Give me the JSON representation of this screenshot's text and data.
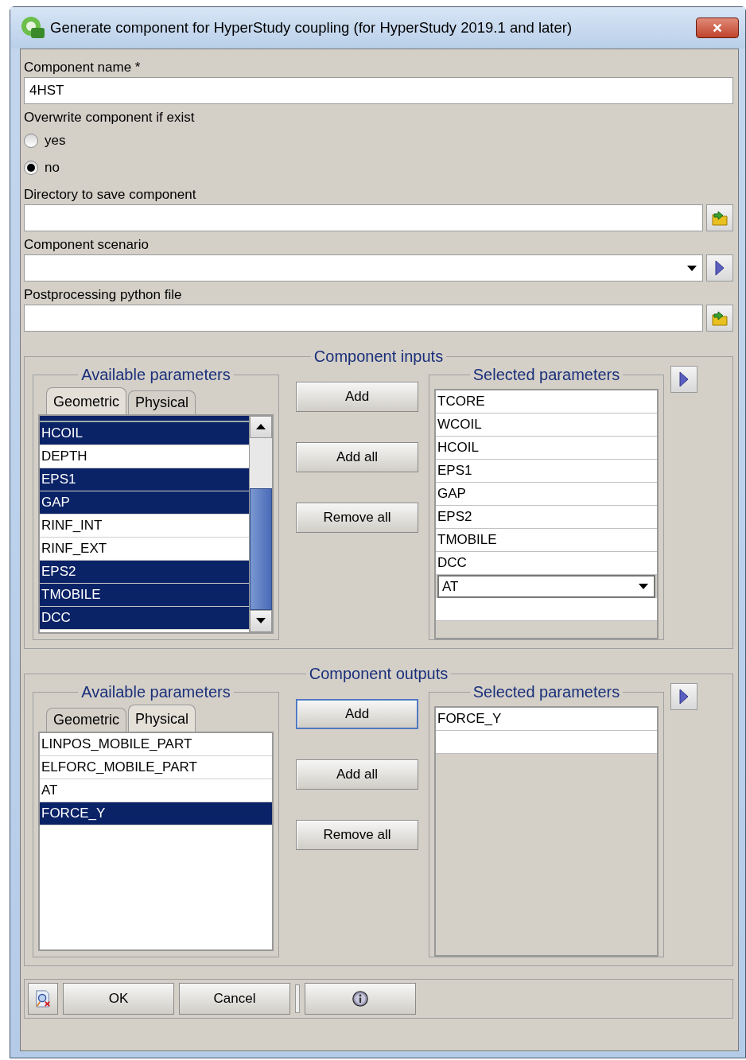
{
  "window": {
    "title": "Generate component for HyperStudy coupling (for HyperStudy 2019.1 and later)"
  },
  "component_name": {
    "label": "Component name *",
    "value": "4HST"
  },
  "overwrite": {
    "label": "Overwrite component if exist",
    "options": [
      {
        "label": "yes",
        "selected": false
      },
      {
        "label": "no",
        "selected": true
      }
    ]
  },
  "directory": {
    "label": "Directory to save component"
  },
  "scenario": {
    "label": "Component scenario"
  },
  "postprocessing": {
    "label": "Postprocessing python file"
  },
  "sections": [
    {
      "title": "Component inputs",
      "available": {
        "title": "Available parameters",
        "tabs": [
          {
            "label": "Geometric",
            "selected": true
          },
          {
            "label": "Physical",
            "selected": false
          }
        ],
        "scrollable": true,
        "items": [
          {
            "label": "HCOIL",
            "selected": true
          },
          {
            "label": "DEPTH",
            "selected": false
          },
          {
            "label": "EPS1",
            "selected": true
          },
          {
            "label": "GAP",
            "selected": true
          },
          {
            "label": "RINF_INT",
            "selected": false
          },
          {
            "label": "RINF_EXT",
            "selected": false
          },
          {
            "label": "EPS2",
            "selected": true
          },
          {
            "label": "TMOBILE",
            "selected": true
          },
          {
            "label": "DCC",
            "selected": true
          }
        ]
      },
      "buttons": [
        {
          "label": "Add",
          "focused": false
        },
        {
          "label": "Add all",
          "focused": false
        },
        {
          "label": "Remove all",
          "focused": false
        }
      ],
      "selected": {
        "title": "Selected parameters",
        "items": [
          {
            "kind": "text",
            "label": "TCORE"
          },
          {
            "kind": "text",
            "label": "WCOIL"
          },
          {
            "kind": "text",
            "label": "HCOIL"
          },
          {
            "kind": "text",
            "label": "EPS1"
          },
          {
            "kind": "text",
            "label": "GAP"
          },
          {
            "kind": "text",
            "label": "EPS2"
          },
          {
            "kind": "text",
            "label": "TMOBILE"
          },
          {
            "kind": "text",
            "label": "DCC"
          },
          {
            "kind": "combo",
            "label": "AT"
          },
          {
            "kind": "empty"
          }
        ]
      }
    },
    {
      "title": "Component outputs",
      "available": {
        "title": "Available parameters",
        "tabs": [
          {
            "label": "Geometric",
            "selected": false
          },
          {
            "label": "Physical",
            "selected": true
          }
        ],
        "scrollable": false,
        "items": [
          {
            "label": "LINPOS_MOBILE_PART",
            "selected": false
          },
          {
            "label": "ELFORC_MOBILE_PART",
            "selected": false
          },
          {
            "label": "AT",
            "selected": false
          },
          {
            "label": "FORCE_Y",
            "selected": true
          }
        ]
      },
      "buttons": [
        {
          "label": "Add",
          "focused": true
        },
        {
          "label": "Add all",
          "focused": false
        },
        {
          "label": "Remove all",
          "focused": false
        }
      ],
      "selected": {
        "title": "Selected parameters",
        "items": [
          {
            "kind": "text",
            "label": "FORCE_Y"
          },
          {
            "kind": "empty"
          }
        ]
      }
    }
  ],
  "footer": {
    "buttons": [
      "OK",
      "Cancel"
    ]
  }
}
